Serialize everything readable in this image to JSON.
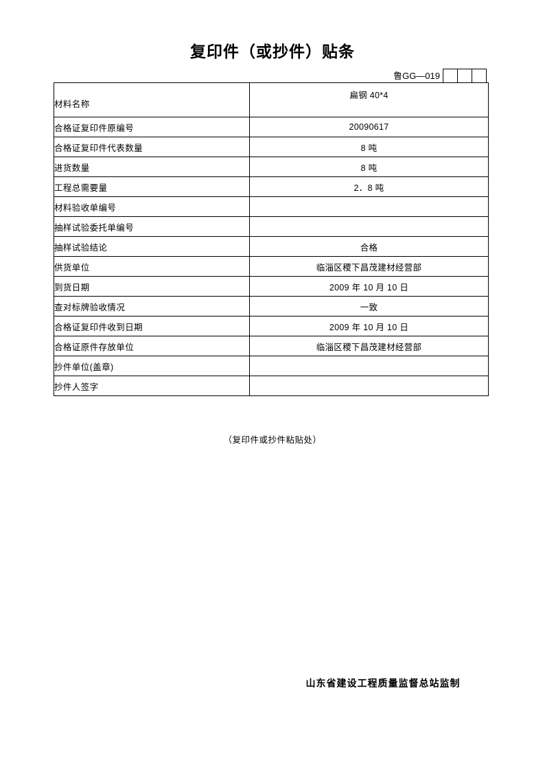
{
  "document": {
    "title": "复印件（或抄件）贴条",
    "form_number": "鲁GG—019",
    "code_boxes": [
      "",
      "",
      ""
    ],
    "paste_area_note": "（复印件或抄件粘贴处）",
    "issuer": "山东省建设工程质量监督总站监制"
  },
  "table": {
    "rows": [
      {
        "label": "材料名称",
        "value": "扁钢 40*4"
      },
      {
        "label": "合格证复印件原编号",
        "value": "20090617"
      },
      {
        "label": "合格证复印件代表数量",
        "value": "8 吨"
      },
      {
        "label": "进货数量",
        "value": "8 吨"
      },
      {
        "label": "工程总需要量",
        "value": "2．8 吨"
      },
      {
        "label": "材料验收单编号",
        "value": ""
      },
      {
        "label": "抽样试验委托单编号",
        "value": ""
      },
      {
        "label": "抽样试验结论",
        "value": "合格"
      },
      {
        "label": "供货单位",
        "value": "临淄区稷下昌茂建材经营部"
      },
      {
        "label": "到货日期",
        "value": "2009 年 10 月 10 日"
      },
      {
        "label": "查对标牌验收情况",
        "value": "一致"
      },
      {
        "label": "合格证复印件收到日期",
        "value": "2009 年 10 月 10 日"
      },
      {
        "label": "合格证原件存放单位",
        "value": "临淄区稷下昌茂建材经营部"
      },
      {
        "label": "抄件单位(盖章)",
        "value": ""
      },
      {
        "label": "抄件人签字",
        "value": ""
      }
    ]
  },
  "colors": {
    "ink": "#000000",
    "paper": "#ffffff"
  }
}
